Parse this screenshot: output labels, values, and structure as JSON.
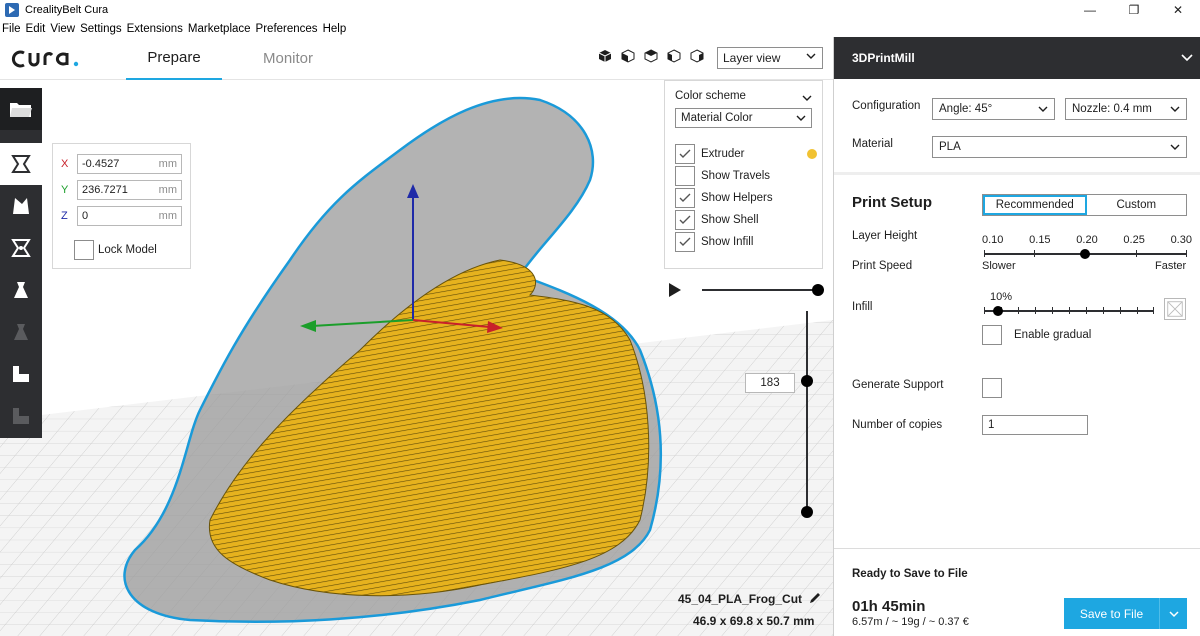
{
  "window": {
    "title": "CrealityBelt Cura",
    "minimize": "—",
    "maximize": "❐",
    "close": "✕"
  },
  "menubar": {
    "items": [
      "File",
      "Edit",
      "View",
      "Settings",
      "Extensions",
      "Marketplace",
      "Preferences",
      "Help"
    ]
  },
  "header": {
    "tabs": [
      {
        "label": "Prepare",
        "active": true
      },
      {
        "label": "Monitor",
        "active": false
      }
    ],
    "view_mode": "Layer view",
    "accent": "#1ea7e1"
  },
  "left_toolbar": {
    "icons": [
      "open-file-icon",
      "move-icon",
      "scale-icon",
      "rotate-icon",
      "mirror-icon",
      "per-model-settings-icon",
      "support-blocker-icon",
      "layer-icon"
    ]
  },
  "move_panel": {
    "x": {
      "label": "X",
      "value": "-0.4527",
      "unit": "mm"
    },
    "y": {
      "label": "Y",
      "value": "236.7271",
      "unit": "mm"
    },
    "z": {
      "label": "Z",
      "value": "0",
      "unit": "mm"
    },
    "lock_label": "Lock Model"
  },
  "color_panel": {
    "header": "Color scheme",
    "selected": "Material Color",
    "options": [
      {
        "label": "Extruder",
        "checked": true
      },
      {
        "label": "Show Travels",
        "checked": false
      },
      {
        "label": "Show Helpers",
        "checked": true
      },
      {
        "label": "Show Shell",
        "checked": true
      },
      {
        "label": "Show Infill",
        "checked": true
      }
    ],
    "extruder_color": "#f1c232"
  },
  "layer_slider": {
    "current_layer": "183"
  },
  "object": {
    "name": "45_04_PLA_Frog_Cut",
    "dimensions": "46.9 x 69.8 x 50.7 mm"
  },
  "sidebar": {
    "machine": "3DPrintMill",
    "configuration_label": "Configuration",
    "angle": "Angle: 45°",
    "nozzle": "Nozzle: 0.4 mm",
    "material_label": "Material",
    "material": "PLA",
    "print_setup": "Print Setup",
    "mode_recommended": "Recommended",
    "mode_custom": "Custom",
    "layer_height_label": "Layer Height",
    "layer_heights": [
      "0.10",
      "0.15",
      "0.20",
      "0.25",
      "0.30"
    ],
    "layer_height_selected": "0.20",
    "print_speed_label": "Print Speed",
    "speed_slower": "Slower",
    "speed_faster": "Faster",
    "infill_label": "Infill",
    "infill_value": "10%",
    "enable_gradual": "Enable gradual",
    "generate_support_label": "Generate Support",
    "copies_label": "Number of copies",
    "copies_value": "1"
  },
  "save": {
    "ready": "Ready to Save to File",
    "time": "01h 45min",
    "stats": "6.57m / ~ 19g / ~ 0.37 €",
    "button": "Save to File"
  }
}
